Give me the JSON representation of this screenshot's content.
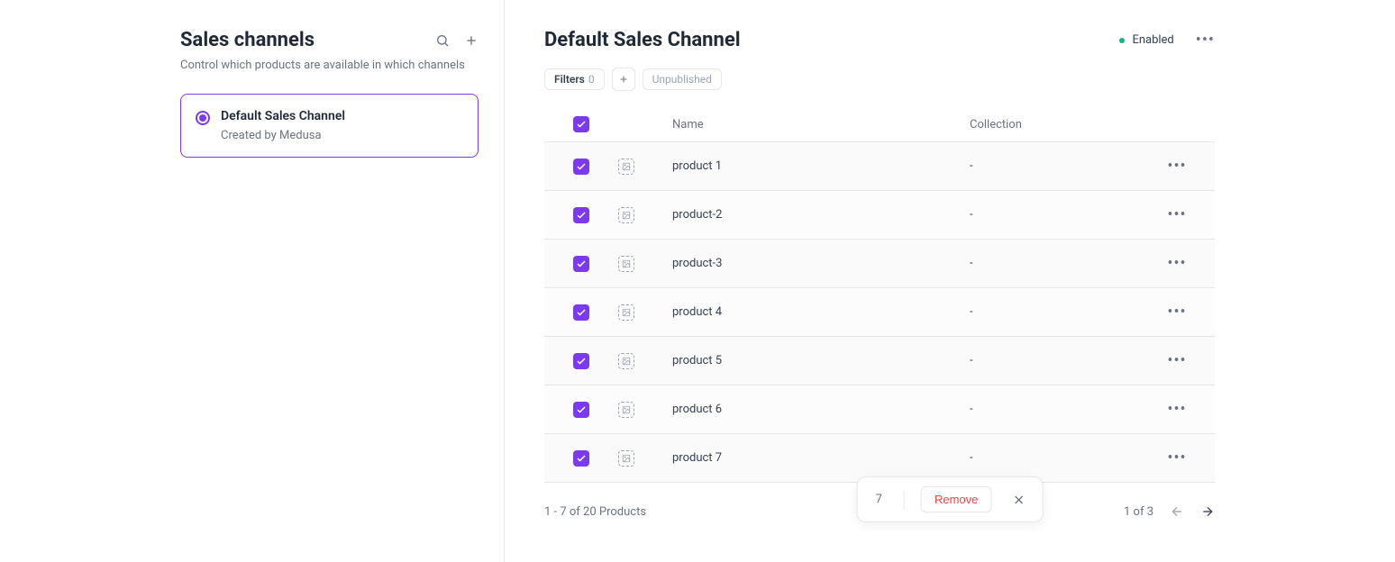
{
  "sidebar": {
    "title": "Sales channels",
    "subtitle": "Control which products are available in which channels",
    "channel": {
      "name": "Default Sales Channel",
      "created_by": "Created by Medusa"
    }
  },
  "main": {
    "title": "Default Sales Channel",
    "status": "Enabled",
    "filters_label": "Filters",
    "filters_count": "0",
    "unpublished_label": "Unpublished",
    "columns": {
      "name": "Name",
      "collection": "Collection"
    },
    "rows": [
      {
        "name": "product 1",
        "collection": "-"
      },
      {
        "name": "product-2",
        "collection": "-"
      },
      {
        "name": "product-3",
        "collection": "-"
      },
      {
        "name": "product 4",
        "collection": "-"
      },
      {
        "name": "product 5",
        "collection": "-"
      },
      {
        "name": "product 6",
        "collection": "-"
      },
      {
        "name": "product 7",
        "collection": "-"
      }
    ],
    "pagination_summary": "1 - 7 of 20 Products",
    "page_indicator": "1 of 3",
    "selection": {
      "count": "7",
      "remove_label": "Remove"
    }
  }
}
